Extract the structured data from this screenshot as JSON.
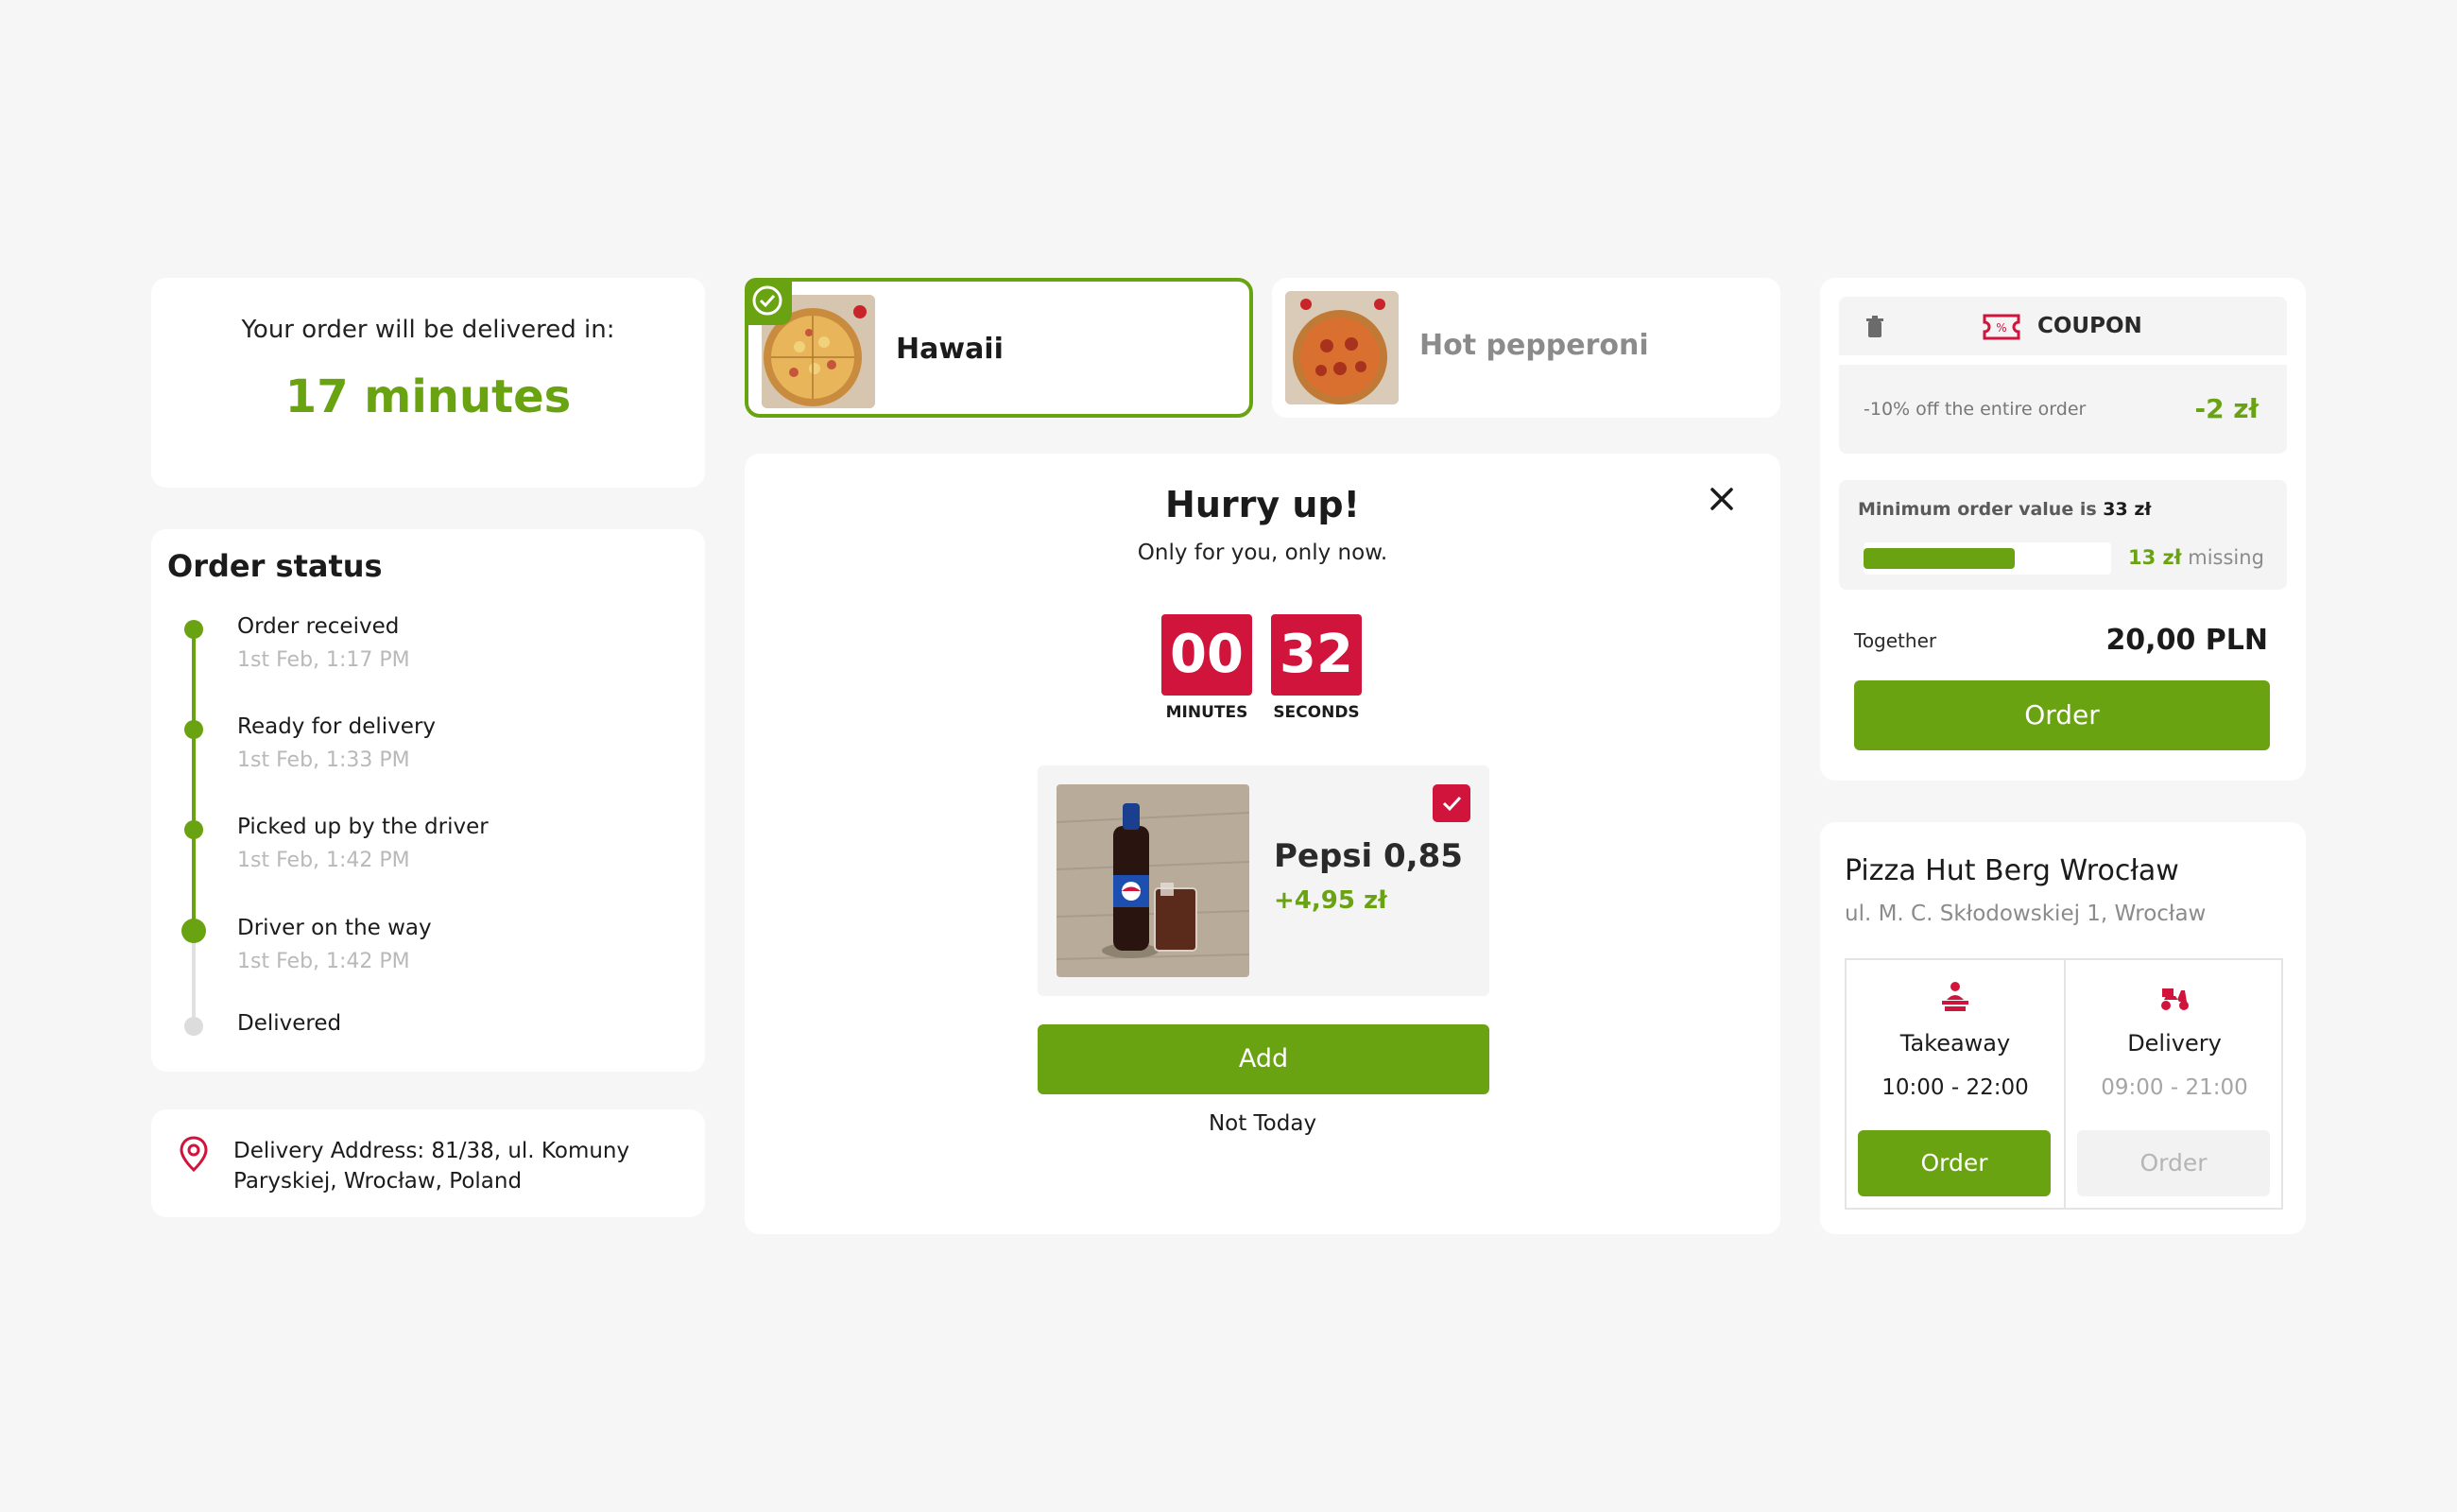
{
  "eta": {
    "label": "Your order will be delivered in:",
    "value": "17 minutes"
  },
  "order_status": {
    "title": "Order status",
    "steps": [
      {
        "name": "Order received",
        "time": "1st Feb, 1:17 PM",
        "state": "done"
      },
      {
        "name": "Ready for delivery",
        "time": "1st Feb, 1:33 PM",
        "state": "done"
      },
      {
        "name": "Picked up by the driver",
        "time": "1st Feb, 1:42 PM",
        "state": "done"
      },
      {
        "name": "Driver on the way",
        "time": "1st Feb, 1:42 PM",
        "state": "current"
      },
      {
        "name": "Delivered",
        "time": "",
        "state": "pending"
      }
    ]
  },
  "address": {
    "text": "Delivery Address: 81/38, ul. Komuny Paryskiej, Wrocław, Poland",
    "icon": "location-pin-icon"
  },
  "pizzas": [
    {
      "name": "Hawaii",
      "selected": true
    },
    {
      "name": "Hot pepperoni",
      "selected": false
    }
  ],
  "offer": {
    "title": "Hurry up!",
    "subtitle": "Only for you, only now.",
    "timer": {
      "minutes": "00",
      "seconds": "32",
      "minutes_label": "MINUTES",
      "seconds_label": "SECONDS"
    },
    "product": {
      "name": "Pepsi 0,85",
      "price": "+4,95 zł",
      "checked": true
    },
    "add_label": "Add",
    "decline_label": "Not Today"
  },
  "cart": {
    "coupon_label": "COUPON",
    "coupon_desc": "-10% off the entire order",
    "coupon_amount": "-2 zł",
    "min_order_prefix": "Minimum order value is",
    "min_order_value": "33 zł",
    "progress_fraction": 0.61,
    "missing_amount": "13 zł",
    "missing_suffix": "missing",
    "together_label": "Together",
    "total": "20,00 PLN",
    "order_label": "Order"
  },
  "store": {
    "name": "Pizza Hut Berg Wrocław",
    "address": "ul. M. C. Skłodowskiej 1, Wrocław",
    "options": [
      {
        "name": "Takeaway",
        "hours": "10:00 - 22:00",
        "button": "Order",
        "enabled": true
      },
      {
        "name": "Delivery",
        "hours": "09:00 - 21:00",
        "button": "Order",
        "enabled": false
      }
    ]
  },
  "colors": {
    "accent": "#6aa312",
    "brand_red": "#d0143b",
    "background": "#f6f6f6"
  }
}
